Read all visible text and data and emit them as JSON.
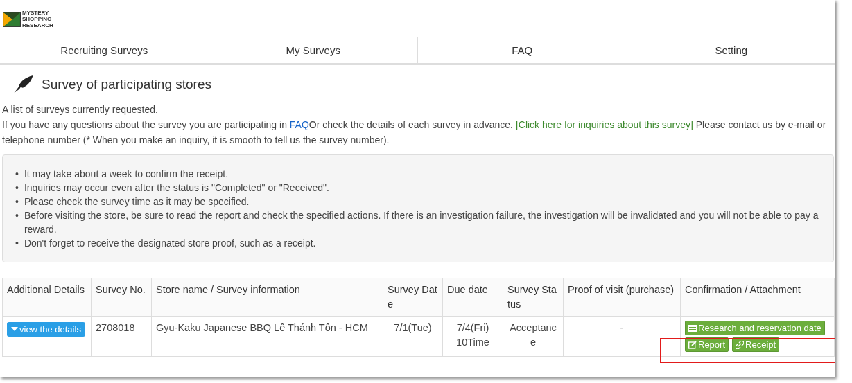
{
  "logo": {
    "lines": [
      "MYSTERY",
      "SHOPPING",
      "RESEARCH"
    ]
  },
  "tabs": [
    {
      "label": "Recruiting Surveys",
      "selected": false
    },
    {
      "label": "My Surveys",
      "selected": false
    },
    {
      "label": "FAQ",
      "selected": false
    },
    {
      "label": "Setting",
      "selected": false
    }
  ],
  "heading": "Survey of participating stores",
  "intro": {
    "first_line": "A list of surveys currently requested.",
    "parts": [
      {
        "kind": "text",
        "text": "If you have any questions about the survey you are participating in "
      },
      {
        "kind": "link",
        "text": "FAQ"
      },
      {
        "kind": "text",
        "text": "Or check the details of each survey in advance. "
      },
      {
        "kind": "inquiry",
        "text": "[Click here for inquiries about this survey]"
      },
      {
        "kind": "text",
        "text": " Please contact us by e-mail or telephone number (* When you make an inquiry, it is smooth to tell us the survey number)."
      }
    ]
  },
  "notice_marker": "•",
  "notices": [
    "It may take about a week to confirm the receipt.",
    "Inquiries may occur even after the status is \"Completed\" or \"Received\".",
    "Please check the survey time as it may be specified.",
    "Before visiting the store, be sure to read the report and check the specified actions. If there is an investigation failure, the investigation will be invalidated and you will not be able to pay a reward.",
    "Don't forget to receive the designated store proof, such as a receipt."
  ],
  "table": {
    "columns": [
      "Additional Details",
      "Survey No.",
      "Store name / Survey information",
      "Survey Date",
      "Due date",
      "Survey Status",
      "Proof of visit (purchase)",
      "Confirmation / Attachment"
    ],
    "rows": [
      {
        "details_button": "view the details",
        "survey_no": "2708018",
        "store": "Gyu-Kaku Japanese BBQ Lê Thánh Tôn - HCM",
        "survey_date": "7/1(Tue)",
        "due_date": [
          "7/4(Fri)",
          "10Time"
        ],
        "status": "Acceptance",
        "proof": "-",
        "actions": [
          {
            "kind": "calendar",
            "label": "Research and reservation date"
          },
          {
            "kind": "report",
            "label": "Report"
          },
          {
            "kind": "receipt",
            "label": "Receipt"
          }
        ]
      }
    ]
  },
  "highlight": {
    "shown": true
  }
}
